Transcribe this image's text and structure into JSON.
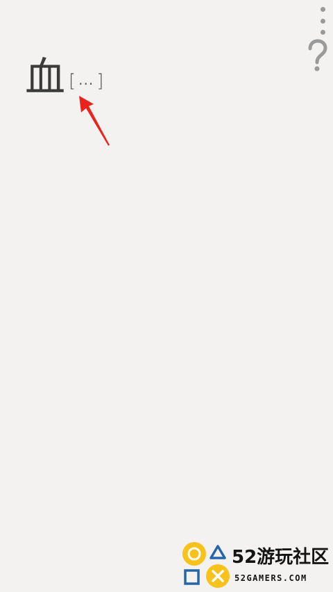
{
  "puzzle": {
    "character": "血",
    "hint_open": "[",
    "hint_placeholder": "...",
    "hint_close": "]"
  },
  "toolbar": {
    "menu_icon": "more-vertical-icon",
    "help_icon": "question-mark-icon"
  },
  "annotation": {
    "arrow_color": "#e8241c"
  },
  "watermark": {
    "brand_main": "52游玩社区",
    "brand_sub": "52GAMERS.COM",
    "accent_yellow": "#f6c21b",
    "accent_blue": "#2466a8"
  }
}
